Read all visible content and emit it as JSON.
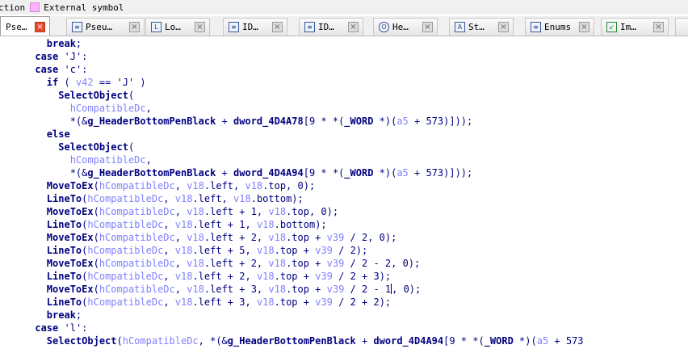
{
  "legend": {
    "item1_partial": "ction",
    "item2_label": "External symbol",
    "item2_color": "#ffb0ff"
  },
  "tabs": [
    {
      "label": "Pse…",
      "icon": "none",
      "active": true
    },
    {
      "label": "Pseu…",
      "icon": "pseudocode-icon"
    },
    {
      "label": "Lo…",
      "icon": "locals-icon"
    },
    {
      "label": "ID…",
      "icon": "ida-view-icon"
    },
    {
      "label": "ID…",
      "icon": "ida-view-icon"
    },
    {
      "label": "He…",
      "icon": "hex-view-icon"
    },
    {
      "label": "St…",
      "icon": "structures-icon"
    },
    {
      "label": "Enums",
      "icon": "enums-icon"
    },
    {
      "label": "Im…",
      "icon": "imports-icon"
    }
  ],
  "code_lines": [
    "        break;",
    "      case 'J':",
    "      case 'c':",
    "        if ( v42 == 'J' )",
    "          SelectObject(",
    "            hCompatibleDc,",
    "            *(&g_HeaderBottomPenBlack + dword_4D4A78[9 * *(_WORD *)(a5 + 573)]));",
    "        else",
    "          SelectObject(",
    "            hCompatibleDc,",
    "            *(&g_HeaderBottomPenBlack + dword_4D4A94[9 * *(_WORD *)(a5 + 573)]));",
    "        MoveToEx(hCompatibleDc, v18.left, v18.top, 0);",
    "        LineTo(hCompatibleDc, v18.left, v18.bottom);",
    "        MoveToEx(hCompatibleDc, v18.left + 1, v18.top, 0);",
    "        LineTo(hCompatibleDc, v18.left + 1, v18.bottom);",
    "        MoveToEx(hCompatibleDc, v18.left + 2, v18.top + v39 / 2, 0);",
    "        LineTo(hCompatibleDc, v18.left + 5, v18.top + v39 / 2);",
    "        MoveToEx(hCompatibleDc, v18.left + 2, v18.top + v39 / 2 - 2, 0);",
    "        LineTo(hCompatibleDc, v18.left + 2, v18.top + v39 / 2 + 3);",
    "        MoveToEx(hCompatibleDc, v18.left + 3, v18.top + v39 / 2 - 1|, 0);",
    "        LineTo(hCompatibleDc, v18.left + 3, v18.top + v39 / 2 + 2);",
    "        break;",
    "      case 'l':",
    "        SelectObject(hCompatibleDc, *(&g_HeaderBottomPenBlack + dword_4D4A94[9 * *(_WORD *)(a5 + 573"
  ],
  "colors": {
    "code_text": "#000080",
    "variable": "#8080ff",
    "active_close": "#e6492a"
  }
}
